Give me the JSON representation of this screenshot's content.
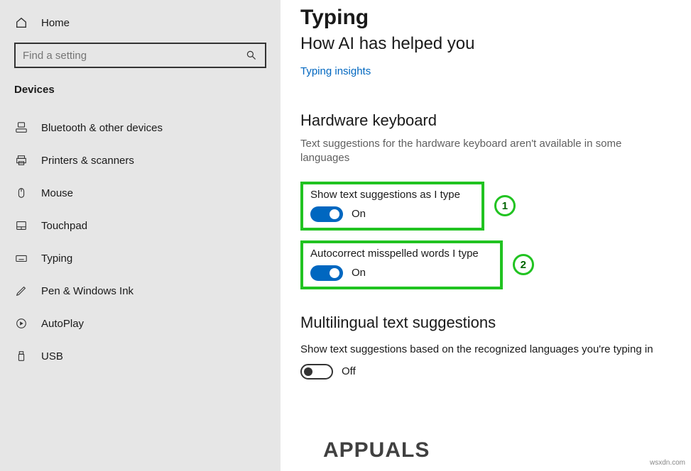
{
  "sidebar": {
    "home_label": "Home",
    "search_placeholder": "Find a setting",
    "section_label": "Devices",
    "items": [
      {
        "label": "Bluetooth & other devices"
      },
      {
        "label": "Printers & scanners"
      },
      {
        "label": "Mouse"
      },
      {
        "label": "Touchpad"
      },
      {
        "label": "Typing"
      },
      {
        "label": "Pen & Windows Ink"
      },
      {
        "label": "AutoPlay"
      },
      {
        "label": "USB"
      }
    ]
  },
  "main": {
    "page_title": "Typing",
    "ai_heading": "How AI has helped you",
    "typing_insights_link": "Typing insights",
    "hw_keyboard_heading": "Hardware keyboard",
    "hw_keyboard_hint": "Text suggestions for the hardware keyboard aren't available in some languages",
    "settings": [
      {
        "label": "Show text suggestions as I type",
        "state": "On",
        "marker": "1"
      },
      {
        "label": "Autocorrect misspelled words I type",
        "state": "On",
        "marker": "2"
      }
    ],
    "multilingual_heading": "Multilingual text suggestions",
    "multilingual_desc": "Show text suggestions based on the recognized languages you're typing in",
    "multilingual_state": "Off"
  },
  "watermark": "APPUALS",
  "credit": "wsxdn.com"
}
